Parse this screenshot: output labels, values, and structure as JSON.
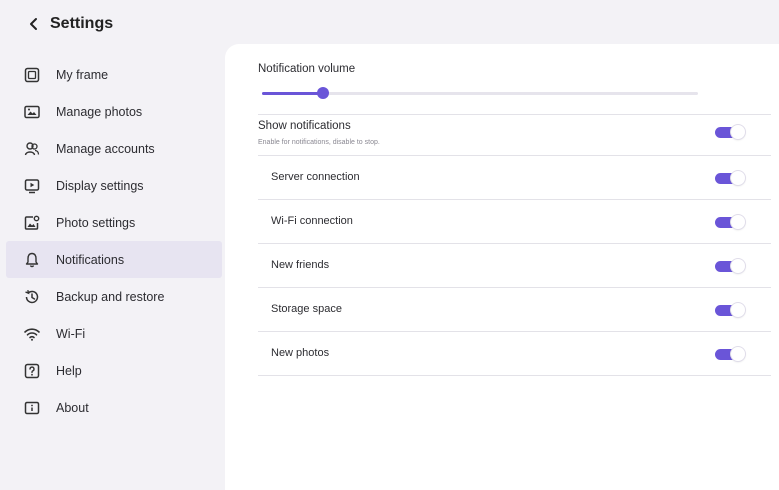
{
  "header": {
    "title": "Settings",
    "back_icon": "back-chevron-icon"
  },
  "sidebar": {
    "active_index": 5,
    "items": [
      {
        "label": "My frame",
        "icon": "frame-icon"
      },
      {
        "label": "Manage photos",
        "icon": "photos-icon"
      },
      {
        "label": "Manage accounts",
        "icon": "accounts-icon"
      },
      {
        "label": "Display settings",
        "icon": "display-icon"
      },
      {
        "label": "Photo settings",
        "icon": "photo-settings-icon"
      },
      {
        "label": "Notifications",
        "icon": "bell-icon"
      },
      {
        "label": "Backup and restore",
        "icon": "backup-icon"
      },
      {
        "label": "Wi-Fi",
        "icon": "wifi-icon"
      },
      {
        "label": "Help",
        "icon": "help-icon"
      },
      {
        "label": "About",
        "icon": "about-icon"
      }
    ]
  },
  "main": {
    "volume": {
      "label": "Notification volume",
      "value_fraction": 0.14
    },
    "show_notifications": {
      "label": "Show notifications",
      "sublabel": "Enable for notifications, disable to stop.",
      "enabled": true
    },
    "toggles": [
      {
        "label": "Server connection",
        "enabled": true
      },
      {
        "label": "Wi-Fi connection",
        "enabled": true
      },
      {
        "label": "New friends",
        "enabled": true
      },
      {
        "label": "Storage space",
        "enabled": true
      },
      {
        "label": "New photos",
        "enabled": true
      }
    ]
  },
  "colors": {
    "accent": "#6a55d8",
    "active_item_bg": "#e7e4f1",
    "background": "#f3f2f6",
    "panel": "#ffffff"
  }
}
